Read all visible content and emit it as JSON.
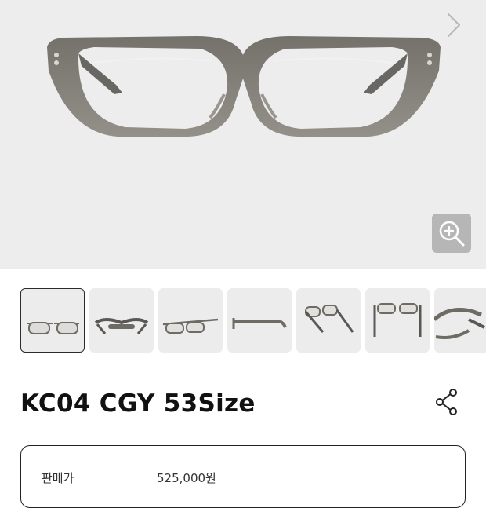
{
  "product": {
    "title": "KC04 CGY 53Size",
    "frame_color": "#7f7a72",
    "lens_tint": "#c9c6c0"
  },
  "gallery": {
    "next_icon": "chevron-right-icon",
    "zoom_icon": "zoom-in-icon",
    "thumbnails": [
      {
        "view": "front",
        "selected": true
      },
      {
        "view": "top",
        "selected": false
      },
      {
        "view": "front-tilted",
        "selected": false
      },
      {
        "view": "side",
        "selected": false
      },
      {
        "view": "three-quarter",
        "selected": false
      },
      {
        "view": "back",
        "selected": false
      },
      {
        "view": "closeup",
        "selected": false
      }
    ]
  },
  "actions": {
    "share_icon": "share-icon"
  },
  "pricing": {
    "label": "판매가",
    "value": "525,000원"
  }
}
